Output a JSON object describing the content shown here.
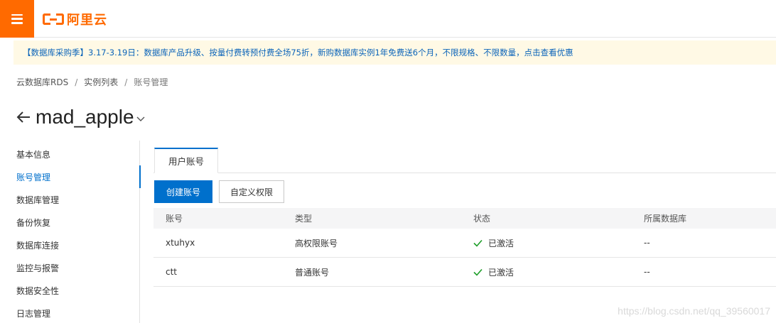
{
  "header": {
    "menu_icon": "hamburger-menu-icon",
    "logo_text": "阿里云",
    "brand_color": "#ff6a00"
  },
  "notice": {
    "text": "【数据库采购季】3.17-3.19日：数据库产品升级、按量付费转预付费全场75折，新购数据库实例1年免费送6个月，不限规格、不限数量，点击查看优惠"
  },
  "breadcrumb": {
    "items": [
      "云数据库RDS",
      "实例列表",
      "账号管理"
    ],
    "separator": "/"
  },
  "page": {
    "title": "mad_apple"
  },
  "sidebar": {
    "items": [
      {
        "label": "基本信息"
      },
      {
        "label": "账号管理"
      },
      {
        "label": "数据库管理"
      },
      {
        "label": "备份恢复"
      },
      {
        "label": "数据库连接"
      },
      {
        "label": "监控与报警"
      },
      {
        "label": "数据安全性"
      },
      {
        "label": "日志管理"
      }
    ],
    "active_index": 1
  },
  "tabs": [
    {
      "label": "用户账号"
    }
  ],
  "toolbar": {
    "create_label": "创建账号",
    "custom_label": "自定义权限"
  },
  "table": {
    "columns": [
      "账号",
      "类型",
      "状态",
      "所属数据库"
    ],
    "rows": [
      {
        "account": "xtuhyx",
        "type": "高权限账号",
        "status": "已激活",
        "database": "--"
      },
      {
        "account": "ctt",
        "type": "普通账号",
        "status": "已激活",
        "database": "--"
      }
    ]
  },
  "watermark": "https://blog.csdn.net/qq_39560017",
  "colors": {
    "primary": "#0070cc",
    "success": "#1e9e29",
    "notice_bg": "#fff9e5"
  }
}
